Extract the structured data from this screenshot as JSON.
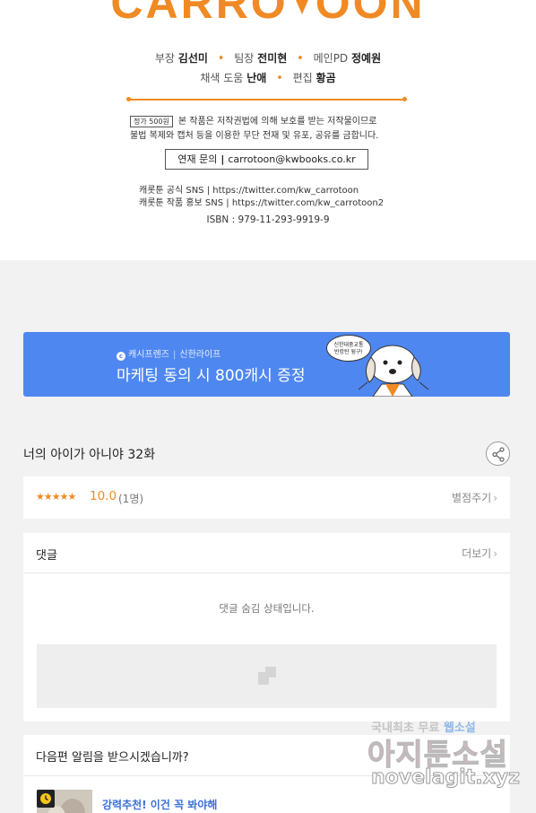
{
  "credits": {
    "logo_left": "CARRO",
    "logo_right": "OON",
    "staff_row1": [
      {
        "role": "부장",
        "name": "김선미"
      },
      {
        "role": "팀장",
        "name": "전미현"
      },
      {
        "role": "메인PD",
        "name": "정예원"
      }
    ],
    "staff_row2": [
      {
        "role": "채색 도움",
        "name": "난애"
      },
      {
        "role": "편집",
        "name": "황곰"
      }
    ],
    "price_tag": "정가 500원",
    "legal_line1": "본 작품은 저작권법에 의해 보호를 받는 저작물이므로",
    "legal_line2": "불법 복제와 캡처 등을 이용한 무단 전재 및 유포, 공유를 금합니다.",
    "contact_label": "연재 문의",
    "contact_bar": "|",
    "contact_email": "carrotoon@kwbooks.co.kr",
    "sns_line1": "캐롯툰 공식 SNS | https://twitter.com/kw_carrotoon",
    "sns_line2": "캐롯툰 작품 홍보 SNS | https://twitter.com/kw_carrotoon2",
    "isbn": "ISBN : 979-11-293-9919-9"
  },
  "banner": {
    "brand1": "캐시프렌즈",
    "brand_sep": "|",
    "brand2": "신한라이프",
    "headline": "마케팅 동의 시 800캐시 증정",
    "bubble_line1": "신한대중교통",
    "bubble_line2": "빈캉탄 뒹구!",
    "bg_color": "#4f87f0"
  },
  "episode": {
    "title": "너의 아이가 아니야 32화",
    "stars": "★★★★★",
    "score": "10.0",
    "count": "(1명)",
    "rate_label": "별점주기",
    "chevron": "›"
  },
  "comments": {
    "title": "댓글",
    "more_label": "더보기",
    "chevron": "›",
    "hidden_message": "댓글 숨김 상태입니다."
  },
  "notify": {
    "title": "다음편 알림을 받으시겠습니까?",
    "recommend_text": "강력추천! 이건 꼭 봐야해"
  },
  "watermark": {
    "line1a": "국내최초 무료",
    "line1b": "웹소설",
    "line2": "아지툰소설",
    "line3": "novelagit.xyz"
  },
  "colors": {
    "accent_orange": "#f08a24",
    "link_blue": "#3b6fd8",
    "page_bg": "#f2f2f2"
  }
}
